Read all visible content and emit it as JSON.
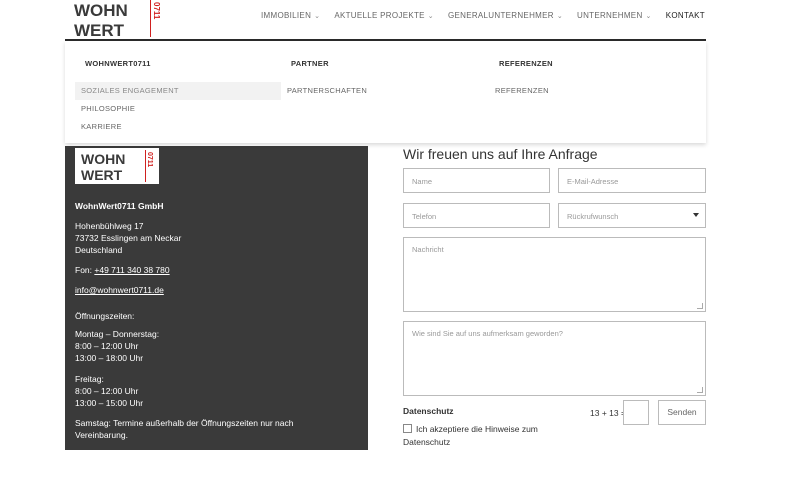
{
  "logo": {
    "text_line1": "WOHN",
    "text_line2": "WERT",
    "text_vertical": "0711",
    "accent": "#d0201f"
  },
  "nav": {
    "items": [
      {
        "label": "IMMOBILIEN",
        "caret": true
      },
      {
        "label": "AKTUELLE PROJEKTE",
        "caret": true
      },
      {
        "label": "GENERALUNTERNEHMER",
        "caret": true
      },
      {
        "label": "UNTERNEHMEN",
        "caret": true
      },
      {
        "label": "KONTAKT",
        "caret": false
      }
    ]
  },
  "mega_menu": {
    "columns": [
      {
        "title": "WOHNWERT0711",
        "links": [
          "SOZIALES ENGAGEMENT",
          "PHILOSOPHIE",
          "KARRIERE"
        ]
      },
      {
        "title": "PARTNER",
        "links": [
          "PARTNERSCHAFTEN"
        ]
      },
      {
        "title": "REFERENZEN",
        "links": [
          "REFERENZEN"
        ]
      }
    ]
  },
  "contact_card": {
    "company": "WohnWert0711 GmbH",
    "street": "Hohenbühlweg 17",
    "city": "73732 Esslingen am Neckar",
    "country": "Deutschland",
    "phone_prefix": "Fon: ",
    "phone": "+49 711 340 38 780",
    "email": "info@wohnwert0711.de",
    "hours_title": "Öffnungszeiten:",
    "mon_thu_label": "Montag – Donnerstag:",
    "mon_thu_1": "8:00 – 12:00 Uhr",
    "mon_thu_2": "13:00 – 18:00 Uhr",
    "fri_label": "Freitag:",
    "fri_1": "8:00 – 12:00 Uhr",
    "fri_2": "13:00 – 15:00 Uhr",
    "sat_line1": "Samstag: Termine außerhalb der Öffnungszeiten nur nach",
    "sat_line2": "Vereinbarung.",
    "bg_color": "#3a3a3a"
  },
  "form": {
    "title": "Wir freuen uns auf Ihre Anfrage",
    "name_placeholder": "Name",
    "email_placeholder": "E-Mail-Adresse",
    "phone_placeholder": "Telefon",
    "callback_selected": "Rückrufwunsch",
    "message_placeholder": "Nachricht",
    "source_placeholder": "Wie sind Sie auf uns aufmerksam geworden?",
    "privacy_label": "Datenschutz",
    "captcha_question": "13 + 13 =",
    "submit_label": "Senden",
    "accept_line1": "Ich akzeptiere die Hinweise zum",
    "accept_line2": "Datenschutz"
  }
}
